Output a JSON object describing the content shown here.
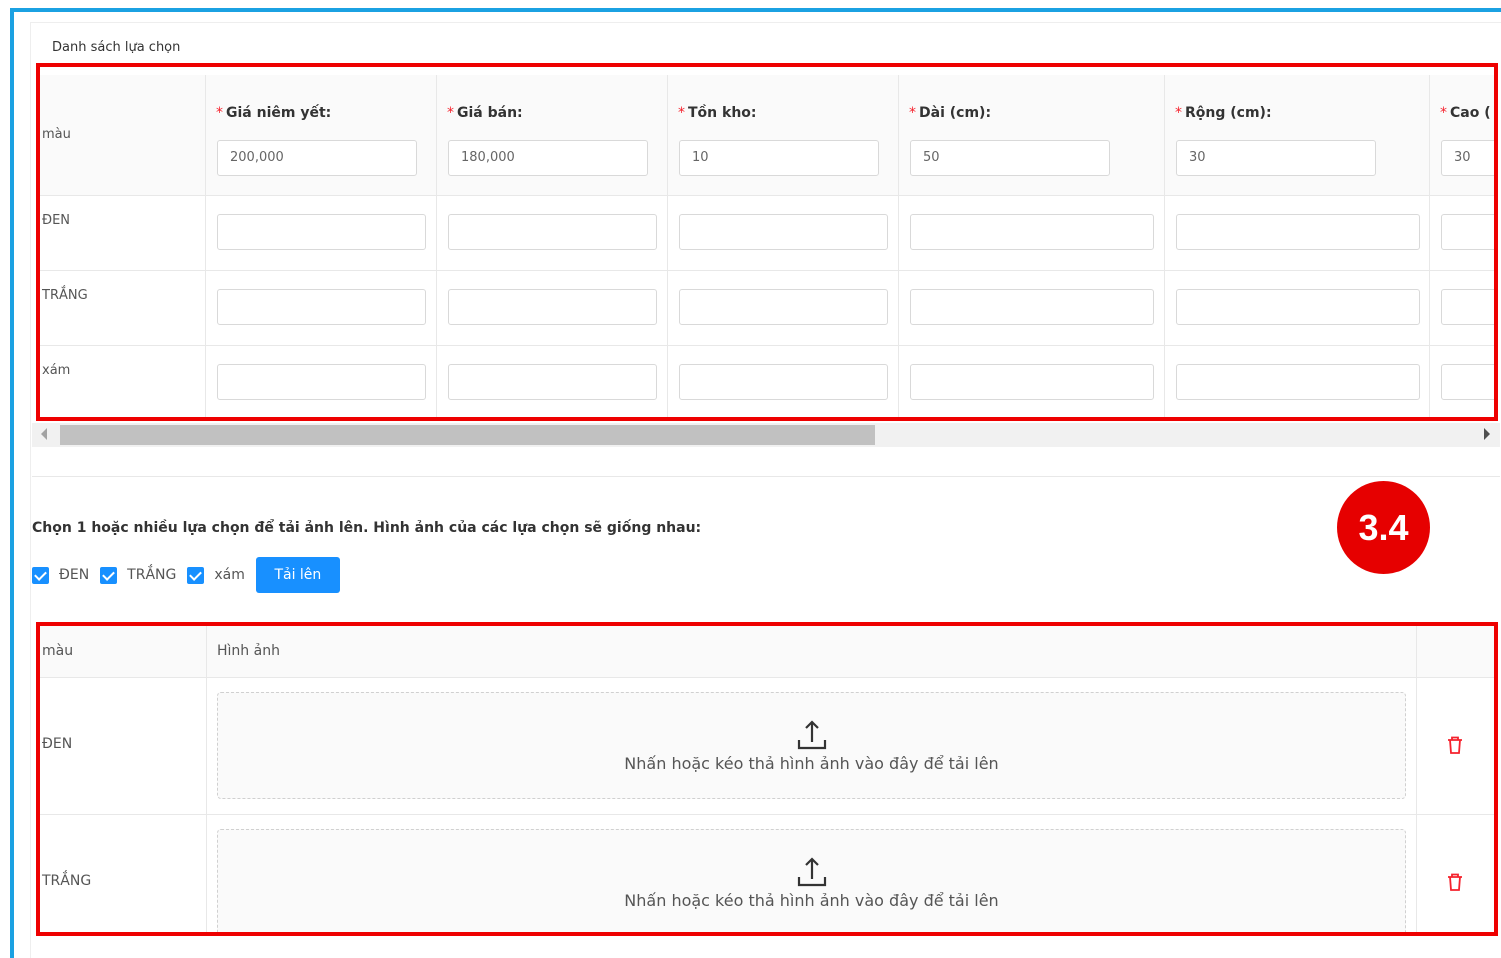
{
  "section_title": "Danh sách lựa chọn",
  "options_table": {
    "row_header": "màu",
    "columns": [
      {
        "label": "Giá niêm yết",
        "value": "200,000"
      },
      {
        "label": "Giá bán",
        "value": "180,000"
      },
      {
        "label": "Tồn kho",
        "value": "10"
      },
      {
        "label": "Dài (cm)",
        "value": "50"
      },
      {
        "label": "Rộng (cm)",
        "value": "30"
      },
      {
        "label": "Cao (",
        "value": "30"
      }
    ],
    "rows": [
      "ĐEN",
      "TRẮNG",
      "xám"
    ]
  },
  "upload": {
    "instruction": "Chọn 1 hoặc nhiều lựa chọn để tải ảnh lên. Hình ảnh của các lựa chọn sẽ giống nhau:",
    "checkboxes": [
      {
        "label": "ĐEN",
        "checked": true
      },
      {
        "label": "TRẮNG",
        "checked": true
      },
      {
        "label": "xám",
        "checked": true
      }
    ],
    "button_label": "Tải lên"
  },
  "image_table": {
    "col_color": "màu",
    "col_image": "Hình ảnh",
    "dropzone_text": "Nhấn hoặc kéo thả hình ảnh vào đây để tải lên",
    "rows": [
      "ĐEN",
      "TRẮNG"
    ]
  },
  "annotation": {
    "badge": "3.4",
    "color": "#ee0000"
  },
  "colors": {
    "primary": "#1890ff",
    "frame": "#1ba1e2",
    "required": "#f5222d",
    "delete": "#f5222d"
  }
}
